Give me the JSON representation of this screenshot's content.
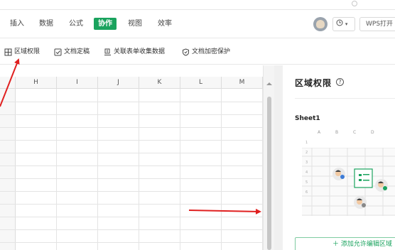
{
  "menu": {
    "tabs": [
      {
        "label": "插入"
      },
      {
        "label": "数据"
      },
      {
        "label": "公式"
      },
      {
        "label": "协作",
        "active": true
      },
      {
        "label": "视图"
      },
      {
        "label": "效率"
      }
    ],
    "active_color": "#1aa35e",
    "wps_button": "WPS打开"
  },
  "toolbar": {
    "items": [
      {
        "label": "区域权限",
        "icon": "region-grid-icon"
      },
      {
        "label": "文档定稿",
        "icon": "checkbox-icon"
      },
      {
        "label": "关联表单收集数据",
        "icon": "form-link-icon"
      },
      {
        "label": "文档加密保护",
        "icon": "shield-icon"
      }
    ]
  },
  "sheet": {
    "columns": [
      "H",
      "I",
      "J",
      "K",
      "L",
      "M"
    ]
  },
  "panel": {
    "title": "区域权限",
    "sheet_name": "Sheet1",
    "illus_columns": [
      "A",
      "B",
      "C",
      "D"
    ],
    "illus_rows": [
      "1",
      "2",
      "3",
      "4",
      "5",
      "6"
    ],
    "add_button": "＋ 添加允许编辑区域"
  },
  "annotation_color": "#e02020"
}
